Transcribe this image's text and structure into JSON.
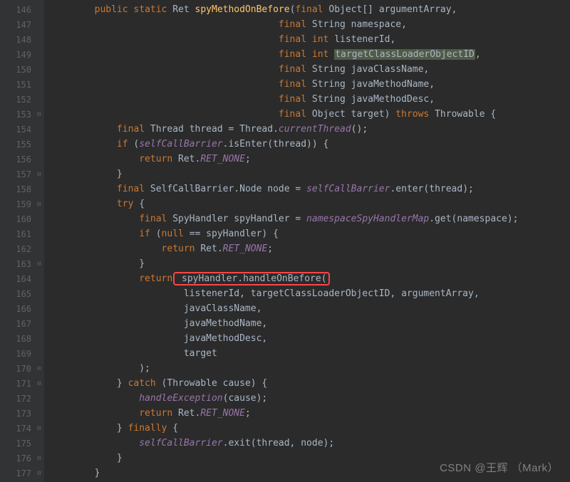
{
  "gutter": {
    "start": 146,
    "end": 177,
    "folds": [
      153,
      157,
      159,
      163,
      170,
      171,
      174,
      176,
      177
    ]
  },
  "code": {
    "lines": [
      [
        [
          "sp",
          "        "
        ],
        [
          "kw",
          "public static "
        ],
        [
          "type",
          "Ret "
        ],
        [
          "method",
          "spyMethodOnBefore"
        ],
        [
          "ident",
          "("
        ],
        [
          "kw",
          "final "
        ],
        [
          "type",
          "Object[] "
        ],
        [
          "ident",
          "argumentArray,"
        ]
      ],
      [
        [
          "sp",
          "                                         "
        ],
        [
          "kw",
          "final "
        ],
        [
          "type",
          "String "
        ],
        [
          "ident",
          "namespace,"
        ]
      ],
      [
        [
          "sp",
          "                                         "
        ],
        [
          "kw",
          "final int "
        ],
        [
          "ident",
          "listenerId,"
        ]
      ],
      [
        [
          "sp",
          "                                         "
        ],
        [
          "kw",
          "final int "
        ],
        [
          "hl",
          "targetClassLoaderObjectID"
        ],
        [
          "ident",
          ","
        ]
      ],
      [
        [
          "sp",
          "                                         "
        ],
        [
          "kw",
          "final "
        ],
        [
          "type",
          "String "
        ],
        [
          "ident",
          "javaClassName,"
        ]
      ],
      [
        [
          "sp",
          "                                         "
        ],
        [
          "kw",
          "final "
        ],
        [
          "type",
          "String "
        ],
        [
          "ident",
          "javaMethodName,"
        ]
      ],
      [
        [
          "sp",
          "                                         "
        ],
        [
          "kw",
          "final "
        ],
        [
          "type",
          "String "
        ],
        [
          "ident",
          "javaMethodDesc,"
        ]
      ],
      [
        [
          "sp",
          "                                         "
        ],
        [
          "kw",
          "final "
        ],
        [
          "type",
          "Object "
        ],
        [
          "ident",
          "target) "
        ],
        [
          "kw",
          "throws "
        ],
        [
          "type",
          "Throwable "
        ],
        [
          "ident",
          "{"
        ]
      ],
      [
        [
          "sp",
          "            "
        ],
        [
          "kw",
          "final "
        ],
        [
          "type",
          "Thread "
        ],
        [
          "ident",
          "thread = Thread."
        ],
        [
          "static-ital",
          "currentThread"
        ],
        [
          "ident",
          "();"
        ]
      ],
      [
        [
          "sp",
          "            "
        ],
        [
          "kw",
          "if "
        ],
        [
          "ident",
          "("
        ],
        [
          "static-field",
          "selfCallBarrier"
        ],
        [
          "ident",
          ".isEnter(thread)) {"
        ]
      ],
      [
        [
          "sp",
          "                "
        ],
        [
          "kw",
          "return "
        ],
        [
          "type",
          "Ret."
        ],
        [
          "const",
          "RET_NONE"
        ],
        [
          "ident",
          ";"
        ]
      ],
      [
        [
          "sp",
          "            "
        ],
        [
          "ident",
          "}"
        ]
      ],
      [
        [
          "sp",
          "            "
        ],
        [
          "kw",
          "final "
        ],
        [
          "type",
          "SelfCallBarrier.Node "
        ],
        [
          "ident",
          "node = "
        ],
        [
          "static-field",
          "selfCallBarrier"
        ],
        [
          "ident",
          ".enter(thread);"
        ]
      ],
      [
        [
          "sp",
          "            "
        ],
        [
          "kw",
          "try "
        ],
        [
          "ident",
          "{"
        ]
      ],
      [
        [
          "sp",
          "                "
        ],
        [
          "kw",
          "final "
        ],
        [
          "type",
          "SpyHandler "
        ],
        [
          "ident",
          "spyHandler = "
        ],
        [
          "static-field",
          "namespaceSpyHandlerMap"
        ],
        [
          "ident",
          ".get(namespace);"
        ]
      ],
      [
        [
          "sp",
          "                "
        ],
        [
          "kw",
          "if "
        ],
        [
          "ident",
          "("
        ],
        [
          "kw",
          "null "
        ],
        [
          "ident",
          "== spyHandler) {"
        ]
      ],
      [
        [
          "sp",
          "                    "
        ],
        [
          "kw",
          "return "
        ],
        [
          "type",
          "Ret."
        ],
        [
          "const",
          "RET_NONE"
        ],
        [
          "ident",
          ";"
        ]
      ],
      [
        [
          "sp",
          "                "
        ],
        [
          "ident",
          "}"
        ]
      ],
      [
        [
          "sp",
          "                "
        ],
        [
          "kw",
          "return"
        ],
        [
          "red",
          " spyHandler.handleOnBefore("
        ]
      ],
      [
        [
          "sp",
          "                        "
        ],
        [
          "ident",
          "listenerId, targetClassLoaderObjectID, argumentArray,"
        ]
      ],
      [
        [
          "sp",
          "                        "
        ],
        [
          "ident",
          "javaClassName,"
        ]
      ],
      [
        [
          "sp",
          "                        "
        ],
        [
          "ident",
          "javaMethodName,"
        ]
      ],
      [
        [
          "sp",
          "                        "
        ],
        [
          "ident",
          "javaMethodDesc,"
        ]
      ],
      [
        [
          "sp",
          "                        "
        ],
        [
          "ident",
          "target"
        ]
      ],
      [
        [
          "sp",
          "                "
        ],
        [
          "ident",
          ");"
        ]
      ],
      [
        [
          "sp",
          "            "
        ],
        [
          "ident",
          "} "
        ],
        [
          "kw",
          "catch "
        ],
        [
          "ident",
          "(Throwable cause) {"
        ]
      ],
      [
        [
          "sp",
          "                "
        ],
        [
          "static-ital",
          "handleException"
        ],
        [
          "ident",
          "(cause);"
        ]
      ],
      [
        [
          "sp",
          "                "
        ],
        [
          "kw",
          "return "
        ],
        [
          "type",
          "Ret."
        ],
        [
          "const",
          "RET_NONE"
        ],
        [
          "ident",
          ";"
        ]
      ],
      [
        [
          "sp",
          "            "
        ],
        [
          "ident",
          "} "
        ],
        [
          "kw",
          "finally "
        ],
        [
          "ident",
          "{"
        ]
      ],
      [
        [
          "sp",
          "                "
        ],
        [
          "static-field",
          "selfCallBarrier"
        ],
        [
          "ident",
          ".exit(thread, node);"
        ]
      ],
      [
        [
          "sp",
          "            "
        ],
        [
          "ident",
          "}"
        ]
      ],
      [
        [
          "sp",
          "        "
        ],
        [
          "ident",
          "}"
        ]
      ]
    ]
  },
  "watermark": "CSDN @王辉 （Mark）"
}
